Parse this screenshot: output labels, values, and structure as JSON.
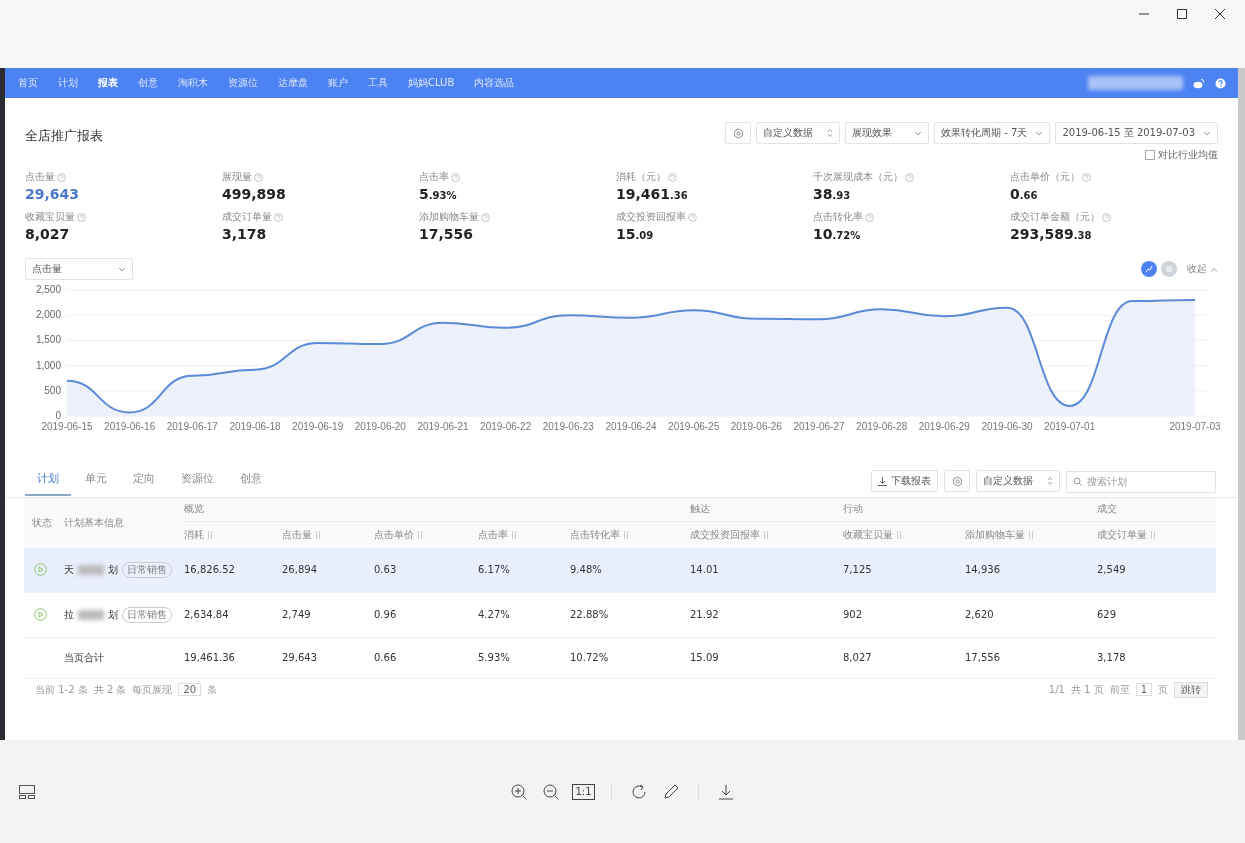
{
  "viewer": {
    "actual_size_label": "1:1"
  },
  "nav": {
    "items": [
      {
        "label": "首页",
        "selected": false
      },
      {
        "label": "计划",
        "selected": false
      },
      {
        "label": "报表",
        "selected": true
      },
      {
        "label": "创意",
        "selected": false
      },
      {
        "label": "淘积木",
        "selected": false
      },
      {
        "label": "资源位",
        "selected": false
      },
      {
        "label": "达摩盘",
        "selected": false
      },
      {
        "label": "账户",
        "selected": false
      },
      {
        "label": "工具",
        "selected": false
      },
      {
        "label": "妈妈CLUB",
        "selected": false
      },
      {
        "label": "内容选品",
        "selected": false
      }
    ]
  },
  "report": {
    "title": "全店推广报表",
    "filters": [
      {
        "kind": "stepper",
        "value": "自定义数据"
      },
      {
        "kind": "select",
        "value": "展现效果"
      },
      {
        "kind": "select",
        "value": "效果转化周期 - 7天"
      },
      {
        "kind": "select",
        "value": "2019-06-15  至  2019-07-03"
      }
    ],
    "compare": {
      "label": "对比行业均值",
      "checked": false
    },
    "metrics": [
      {
        "label": "点击量",
        "value": "29,643",
        "selected": true
      },
      {
        "label": "展现量",
        "value": "499,898",
        "selected": false
      },
      {
        "label": "点击率",
        "value": "5",
        "decimals": ".93%",
        "selected": false
      },
      {
        "label": "消耗（元）",
        "value": "19,461",
        "decimals": ".36",
        "selected": false
      },
      {
        "label": "千次展现成本（元）",
        "value": "38",
        "decimals": ".93",
        "selected": false
      },
      {
        "label": "点击单价（元）",
        "value": "0",
        "decimals": ".66",
        "selected": false
      },
      {
        "label": "收藏宝贝量",
        "value": "8,027",
        "selected": false
      },
      {
        "label": "成交订单量",
        "value": "3,178",
        "selected": false
      },
      {
        "label": "添加购物车量",
        "value": "17,556",
        "selected": false
      },
      {
        "label": "成交投资回报率",
        "value": "15",
        "decimals": ".09",
        "selected": false
      },
      {
        "label": "点击转化率",
        "value": "10",
        "decimals": ".72%",
        "selected": false
      },
      {
        "label": "成交订单金额（元）",
        "value": "293,589",
        "decimals": ".38",
        "selected": false
      }
    ]
  },
  "chart": {
    "views": [
      {
        "kind": "line",
        "selected": true
      },
      {
        "kind": "table",
        "selected": false
      }
    ],
    "collapse_label": "收起",
    "chart_data": {
      "type": "area",
      "categories": [
        "2019-06-15",
        "2019-06-16",
        "2019-06-17",
        "2019-06-18",
        "2019-06-19",
        "2019-06-20",
        "2019-06-21",
        "2019-06-22",
        "2019-06-23",
        "2019-06-24",
        "2019-06-25",
        "2019-06-26",
        "2019-06-27",
        "2019-06-28",
        "2019-06-29",
        "2019-06-30",
        "2019-07-01",
        null,
        "2019-07-03"
      ],
      "series": [
        {
          "name": "点击量",
          "color": "#5b8ad6",
          "values": [
            700,
            70,
            800,
            920,
            1450,
            1430,
            1850,
            1750,
            2000,
            1950,
            2100,
            1930,
            1920,
            2120,
            1980,
            2150,
            200,
            2280,
            2300
          ]
        }
      ],
      "ylim": [
        0,
        2500
      ],
      "grid": true,
      "yticks": [
        {
          "value": 0,
          "label": "0"
        },
        {
          "value": 500,
          "label": "500"
        },
        {
          "value": 1000,
          "label": "1,000"
        },
        {
          "value": 1500,
          "label": "1,500"
        },
        {
          "value": 2000,
          "label": "2,000"
        },
        {
          "value": 2500,
          "label": "2,500"
        }
      ]
    }
  },
  "table": {
    "tabs": [
      {
        "label": "计划",
        "selected": true
      },
      {
        "label": "单元",
        "selected": false
      },
      {
        "label": "定向",
        "selected": false
      },
      {
        "label": "资源位",
        "selected": false
      },
      {
        "label": "创意",
        "selected": false
      }
    ],
    "download_button": "下载报表",
    "custom_select": "自定义数据",
    "search": {
      "placeholder": "搜索计划"
    },
    "fixed_columns": [
      "状态",
      "计划基本信息"
    ],
    "groups": [
      {
        "label": "概览",
        "columns": [
          "消耗",
          "点击量",
          "点击单价",
          "点击率",
          "点击转化率"
        ]
      },
      {
        "label": "触达",
        "columns": [
          "成交投资回报率"
        ]
      },
      {
        "label": "行动",
        "columns": [
          "收藏宝贝量",
          "添加购物车量"
        ]
      },
      {
        "label": "成交",
        "columns": [
          "成交订单量"
        ]
      }
    ],
    "rows": [
      {
        "kind": "plan",
        "name_start": "天",
        "name_end": "划",
        "tag": "日常销售",
        "selected": true,
        "cells": [
          "16,826.52",
          "26,894",
          "0.63",
          "6.17%",
          "9.48%",
          "14.01",
          "7,125",
          "14,936",
          "2,549"
        ]
      },
      {
        "kind": "plan",
        "name_start": "拉",
        "name_end": "划",
        "tag": "日常销售",
        "selected": false,
        "cells": [
          "2,634.84",
          "2,749",
          "0.96",
          "4.27%",
          "22.88%",
          "21.92",
          "902",
          "2,620",
          "629"
        ]
      },
      {
        "kind": "total",
        "label": "当页合计",
        "selected": false,
        "cells": [
          "19,461.36",
          "29,643",
          "0.66",
          "5.93%",
          "10.72%",
          "15.09",
          "8,027",
          "17,556",
          "3,178"
        ]
      }
    ],
    "pagination": {
      "left": [
        "当前 1-2 条",
        "共 2 条",
        "每页展现"
      ],
      "page_size": "20",
      "page_size_unit": "条",
      "right": [
        "1/1",
        "共 1 页",
        "前至"
      ],
      "page_input": "1",
      "page_unit": "页",
      "go_button": "跳转"
    }
  }
}
